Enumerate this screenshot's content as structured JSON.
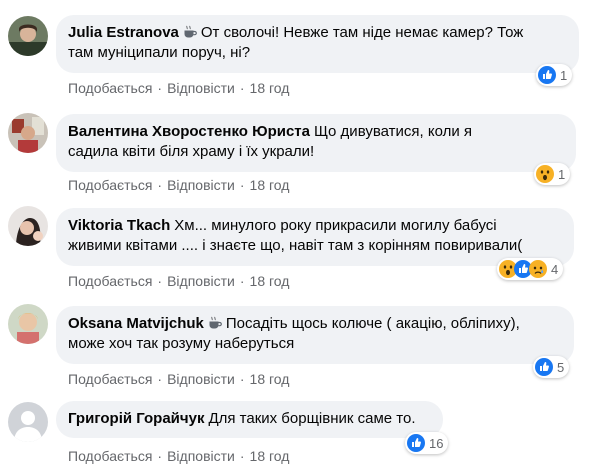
{
  "actions": {
    "like": "Подобається",
    "reply": "Відповісти"
  },
  "comments": [
    {
      "author": "Julia Estranova",
      "text_line1": "От сволочі! Невже там ніде немає камер? Тож",
      "text_line2": "там муніципали поруч, ні?",
      "time": "18 год",
      "reaction_count": "1",
      "reactions": [
        "like"
      ]
    },
    {
      "author": "Валентина Хворостенко Юриста",
      "text_line1": "Що дивуватися, коли я",
      "text_line2": "садила квіти біля храму і їх украли!",
      "time": "18 год",
      "reaction_count": "1",
      "reactions": [
        "wow"
      ]
    },
    {
      "author": "Viktoria Tkach",
      "text_line1": "Хм... минулого року прикрасили могилу бабусі",
      "text_line2": "живими квітами .... і знаєте що, навіт там з корінням повиривали(",
      "time": "18 год",
      "reaction_count": "4",
      "reactions": [
        "wow",
        "like",
        "sad"
      ]
    },
    {
      "author": "Oksana Matvijchuk",
      "text_line1": "Посадіть щось колюче ( акацію, обліпиху),",
      "text_line2": "може хоч так розуму наберуться",
      "time": "18 год",
      "reaction_count": "5",
      "reactions": [
        "like"
      ]
    },
    {
      "author": "Григорій Горайчук",
      "text_line1": "Для таких борщівник саме то.",
      "text_line2": "",
      "time": "18 год",
      "reaction_count": "16",
      "reactions": [
        "like"
      ]
    }
  ],
  "colors": {
    "like": "#1877f2",
    "wow": "#f7b125",
    "bubble": "#f0f2f5",
    "meta": "#65676b"
  }
}
